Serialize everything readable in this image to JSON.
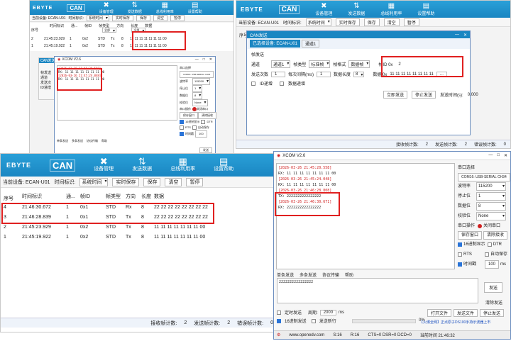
{
  "brand": {
    "logo": "EBYTE",
    "can": "CAN"
  },
  "toolbar": {
    "device_mgmt": "设备管理",
    "send_data": "发送数据",
    "bus_util": "总线利用率",
    "settings_help": "设置帮助"
  },
  "subbar": {
    "current_device_label": "当前设备: ECAN-U01",
    "timestamp_label": "时间标识:",
    "timestamp_value": "系统时间",
    "realtime_save": "实时保存",
    "save": "保存",
    "clear": "清空",
    "pause": "暂停"
  },
  "table_headers": {
    "seq": "序号",
    "time": "时间标识",
    "channel": "通...",
    "frame_id": "帧ID",
    "frame_type": "帧类型",
    "direction": "方向",
    "length": "长度",
    "data": "数据"
  },
  "filter": {
    "all": "全部",
    "value": "全部"
  },
  "top_left_rows": [
    {
      "seq": "2",
      "time": "21:45:23.929",
      "ch": "1",
      "id": "0x2",
      "type": "STD",
      "dir": "Tx",
      "len": "8",
      "data": "11 11 11 11 11 11 11 00"
    },
    {
      "seq": "1",
      "time": "21:45:19.922",
      "ch": "1",
      "id": "0x2",
      "type": "STD",
      "dir": "Tx",
      "len": "8",
      "data": "11 11 11 11 11 11 11 00"
    }
  ],
  "bottom_rows": [
    {
      "seq": "4",
      "time": "21:46:30.672",
      "ch": "1",
      "id": "0x1",
      "type": "STD",
      "dir": "Rx",
      "len": "8",
      "data": "22 22 22 22 22 22 22 22"
    },
    {
      "seq": "3",
      "time": "21:46:28.839",
      "ch": "1",
      "id": "0x1",
      "type": "STD",
      "dir": "Tx",
      "len": "8",
      "data": "22 22 22 22 22 22 22 22"
    },
    {
      "seq": "2",
      "time": "21:45:23.929",
      "ch": "1",
      "id": "0x2",
      "type": "STD",
      "dir": "Tx",
      "len": "8",
      "data": "11 11 11 11 11 11 11 00"
    },
    {
      "seq": "1",
      "time": "21:45:19.922",
      "ch": "1",
      "id": "0x2",
      "type": "STD",
      "dir": "Tx",
      "len": "8",
      "data": "11 11 11 11 11 11 11 00"
    }
  ],
  "canwin": {
    "title": "CAN发送",
    "tab_active": "已选择设备: ECAN-U01",
    "tab2": "通道1",
    "section": "帧发送",
    "channel_label": "通道",
    "channel_value": "通道1",
    "frame_type_label": "帧类型",
    "frame_type_value": "标准帧",
    "frame_format_label": "帧格式",
    "frame_format_value": "数据帧",
    "frame_id_label": "帧ID 0x",
    "frame_id_value": "2",
    "send_times_label": "发送次数",
    "send_times_value": "1",
    "interval_label": "每次间隔(ms)",
    "interval_value": "1",
    "data_len_label": "数据长度",
    "data_len_value": "8",
    "data_label": "数据 0x",
    "data_value": "11 11 11 11 11 11 11 11",
    "id_inc": "ID递增",
    "data_inc": "数据递增",
    "send_button": "立即发送",
    "stop_button": "停止发送",
    "elapsed_label": "发送时间(s):",
    "elapsed_value": "0.000",
    "small_side_items": [
      "帧发送",
      "通道",
      "发送次",
      "ID递增"
    ]
  },
  "status": {
    "recv_label": "接收帧计数:",
    "recv_value": "2",
    "send_label": "发送帧计数:",
    "send_value": "2",
    "err_label": "错误帧计数:",
    "err_value": "0"
  },
  "xcom": {
    "title": "XCOM V2.6",
    "log": [
      {
        "ts": "[2026-03-26 21:45:20.558]",
        "msg": "RX: 11 11 11 11 11 11 11 00"
      },
      {
        "ts": "[2026-03-26 21:45:24.048]",
        "msg": "RX: 11 11 11 11 11 11 11 00"
      },
      {
        "ts": "[2026-03-26 21:46:28.808]",
        "msg": "TX: 2222222222222222"
      },
      {
        "ts": "[2026-03-26 21:46:30.671]",
        "msg": "RX: 2222222222222222"
      }
    ],
    "port_select_label": "串口选择",
    "port_value": "COM16: USB-SERIAL CH34",
    "baud_label": "波特率",
    "baud_value": "115200",
    "stop_label": "停止位",
    "stop_value": "1",
    "data_label": "数据位",
    "data_value": "8",
    "parity_label": "校验位",
    "parity_value": "None",
    "op_label": "串口操作",
    "close_port": "关闭串口",
    "save_window": "保存窗口",
    "clear_recv": "清除接收",
    "hex_show": "16进制显示",
    "dtr": "DTR",
    "rts": "RTS",
    "auto_save": "自动保存",
    "timestamp": "时间戳",
    "ms_value": "100",
    "ms_unit": "ms",
    "tabs": [
      "单条发送",
      "多条发送",
      "协议传输",
      "帮助"
    ],
    "send_text": "2222222222222222",
    "send_button": "发送",
    "clear_send": "清除发送",
    "timed_send": "定时发送",
    "period_label": "周期:",
    "period_value": "2000",
    "period_unit": "ms",
    "hex_send": "16进制发送",
    "send_newline": "发送新行",
    "percent": "0%",
    "open_file": "打开文件",
    "send_file": "发送文件",
    "stop_send": "停止发送",
    "promo": "【火爆全网】正点原子DS100手持示波器上市",
    "website": "www.openedv.com",
    "s_count": "S:16",
    "r_count": "R:16",
    "signals": "CTS=0 DSR=0 DCD=0",
    "time": "当前时间 21:46:32"
  },
  "colors": {
    "accent": "#1a86c2",
    "highlight": "#e02020"
  }
}
